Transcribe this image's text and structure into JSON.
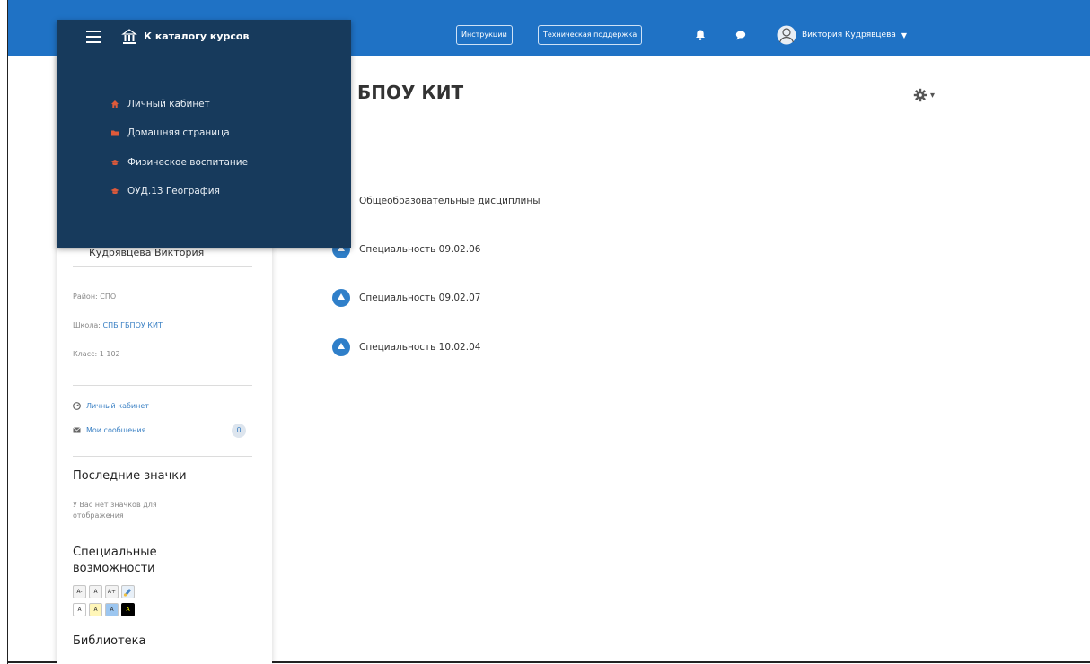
{
  "topbar": {
    "instructions_label": "Инструкции",
    "support_label": "Техническая поддержка",
    "user_name": "Виктория Кудрявцева",
    "bell_icon": "bell-icon",
    "chat_icon": "chat-icon",
    "accent_color": "#1f72c5"
  },
  "nav": {
    "title": "К каталогу курсов",
    "items": [
      {
        "label": "Личный кабинет",
        "icon": "home-icon"
      },
      {
        "label": "Домашняя страница",
        "icon": "folder-icon"
      },
      {
        "label": "Физическое воспитание",
        "icon": "hat-icon"
      },
      {
        "label": "ОУД.13 География",
        "icon": "hat-icon"
      }
    ],
    "panel_color": "#173a5c"
  },
  "page": {
    "title": "БПОУ КИТ"
  },
  "categories": [
    {
      "label": "Общеобразовательные дисциплины"
    },
    {
      "label": "Специальность 09.02.06"
    },
    {
      "label": "Специальность 09.02.07"
    },
    {
      "label": "Специальность 10.02.04"
    }
  ],
  "sidebar": {
    "profile_name": "Кудрявцева Виктория",
    "district_label": "Район:",
    "district_value": "СПО",
    "school_label": "Школа:",
    "school_value": "СПБ ГБПОУ КИТ",
    "class_label": "Класс:",
    "class_value": "1 102",
    "cabinet_link": "Личный кабинет",
    "messages_link": "Мои сообщения",
    "messages_count": "0",
    "badges_heading": "Последние значки",
    "badges_note": "У Вас нет значков для отображения",
    "accessibility_heading": "Специальные возможности",
    "library_heading": "Библиотека",
    "a11y_row1": [
      "A-",
      "A",
      "A+"
    ],
    "a11y_row2": [
      "A",
      "A",
      "A",
      "A"
    ]
  }
}
